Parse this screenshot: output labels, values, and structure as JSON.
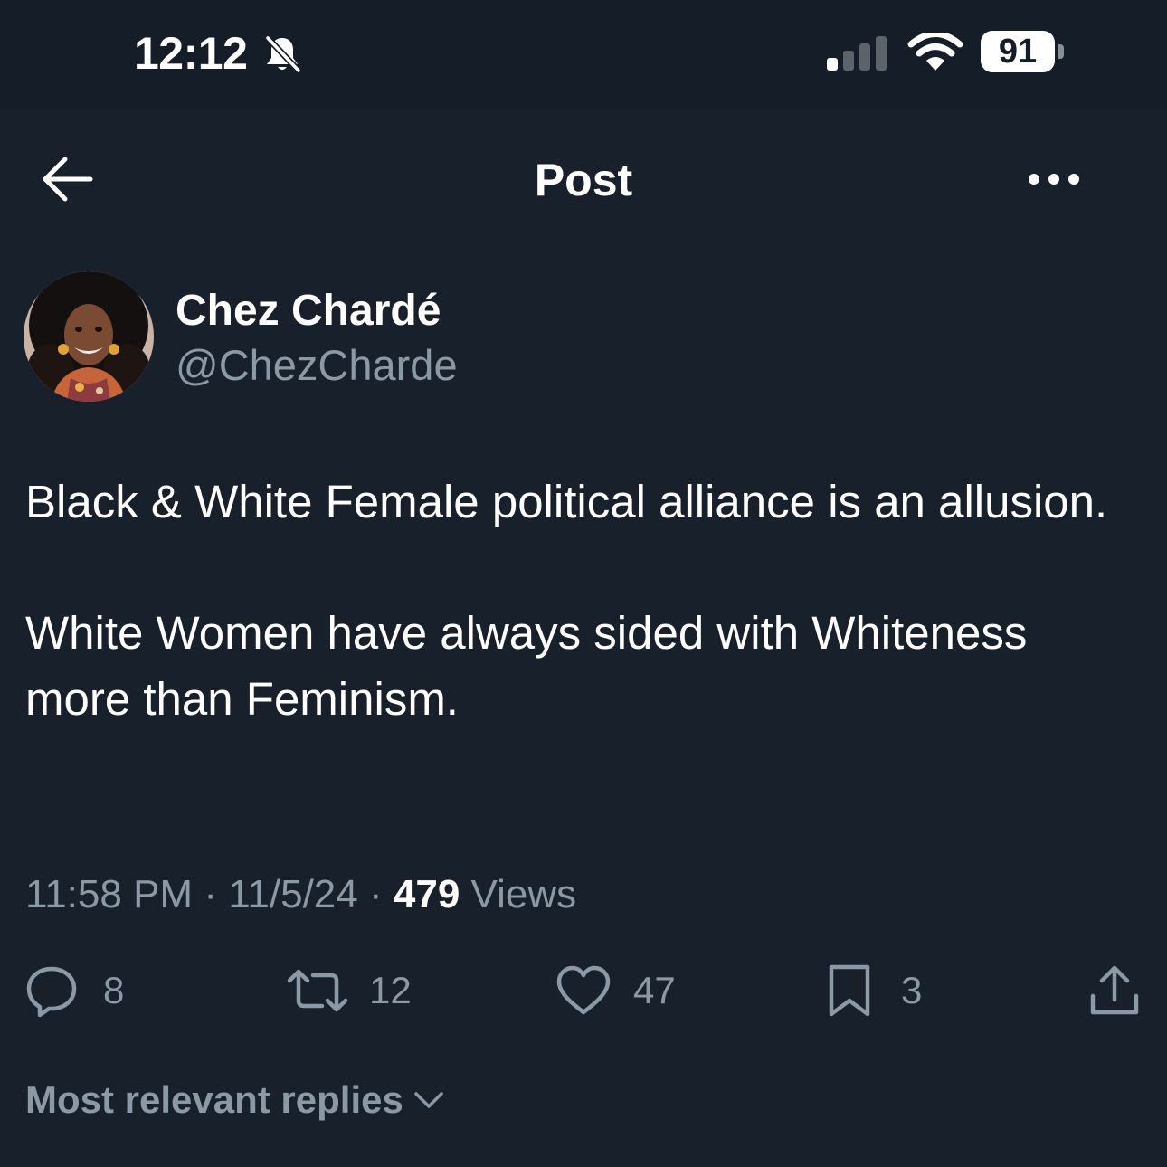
{
  "status_bar": {
    "time": "12:12",
    "battery": "91",
    "icons": [
      "bell-slash-icon",
      "cellular-signal-icon",
      "wifi-icon",
      "battery-icon"
    ]
  },
  "header": {
    "title": "Post",
    "back_icon": "arrow-left-icon",
    "more_icon": "ellipsis-icon"
  },
  "post": {
    "author": {
      "name": "Chez Chardé",
      "handle": "@ChezCharde"
    },
    "paragraphs": [
      "Black & White Female political alliance is an allusion.",
      "White Women have always sided with Whiteness more than Feminism."
    ],
    "time": "11:58 PM",
    "date": "11/5/24",
    "separator": "·",
    "views_count": "479",
    "views_label": "Views",
    "actions": {
      "replies": "8",
      "reposts": "12",
      "likes": "47",
      "bookmarks": "3"
    }
  },
  "replies_sort": {
    "label": "Most relevant replies"
  },
  "colors": {
    "background": "#18202b",
    "text": "#ffffff",
    "secondary_text": "#8b98a5"
  }
}
